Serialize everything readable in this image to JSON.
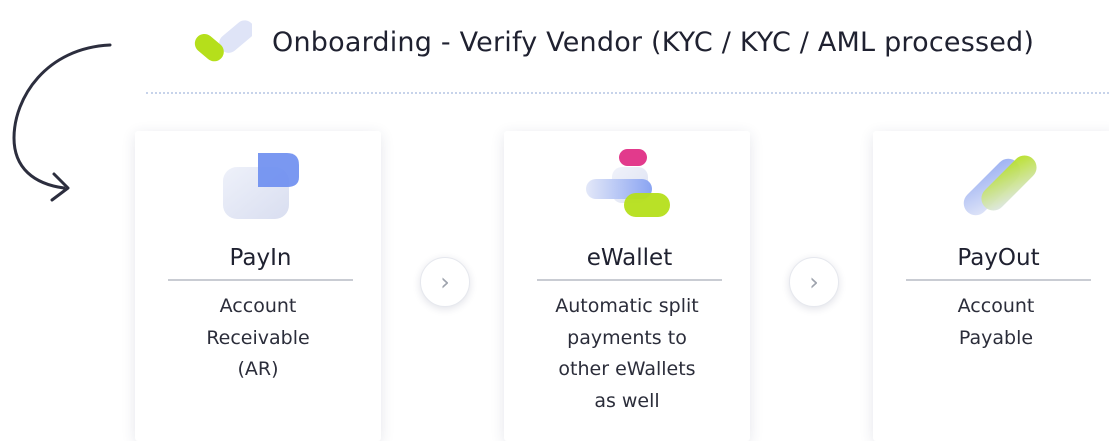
{
  "header": {
    "title": "Onboarding - Verify Vendor (KYC / KYC / AML processed)",
    "icon": "check-icon"
  },
  "colors": {
    "accent_green": "#b5df1b",
    "accent_blue": "#6b8ef0",
    "accent_pink": "#e23a8c",
    "pale_blue": "#dfe5f7"
  },
  "cards": [
    {
      "name": "PayIn",
      "icon": "payin-icon",
      "description": "Account\nReceivable\n(AR)"
    },
    {
      "name": "eWallet",
      "icon": "ewallet-icon",
      "description": "Automatic split\npayments to\nother eWallets\nas well"
    },
    {
      "name": "PayOut",
      "icon": "payout-icon",
      "description": "Account\nPayable"
    }
  ],
  "connectors": [
    {
      "icon": "chevron-right-icon",
      "glyph": "›"
    },
    {
      "icon": "chevron-right-icon",
      "glyph": "›"
    }
  ]
}
